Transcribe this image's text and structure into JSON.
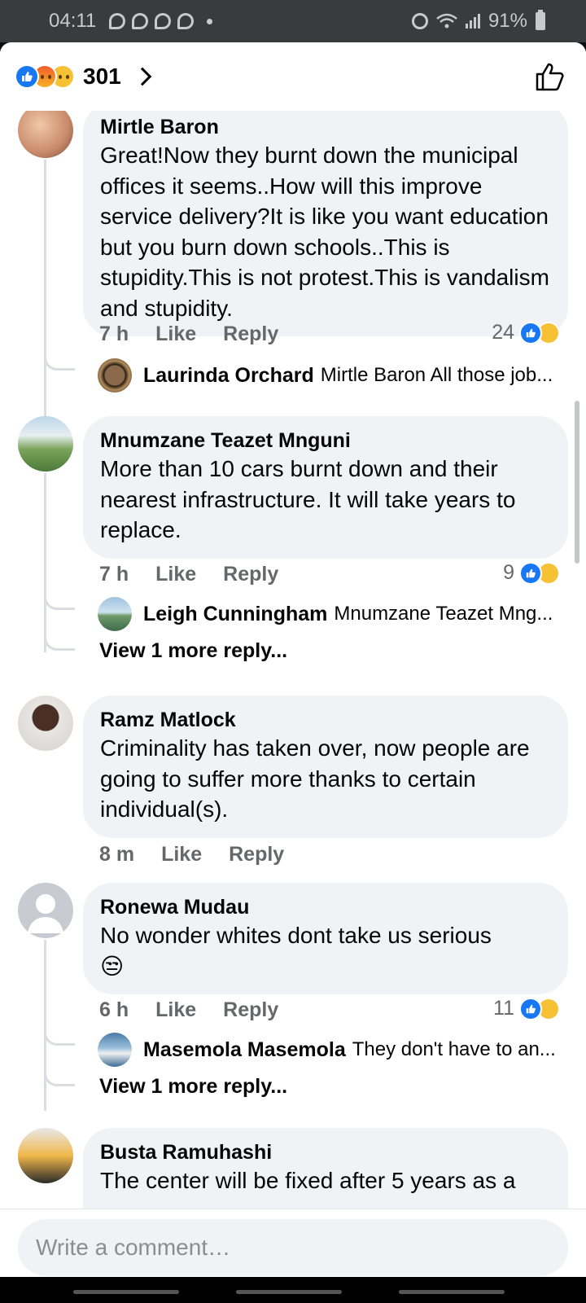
{
  "status_bar": {
    "time": "04:11",
    "battery": "91%"
  },
  "header": {
    "reaction_count": "301"
  },
  "comments": [
    {
      "author": "Mirtle Baron",
      "text": "Great!Now they burnt down the municipal offices it seems..How will this improve service delivery?It is like you want education but you burn down schools..This is stupidity.This is not protest.This is vandalism and stupidity.",
      "time": "7 h",
      "like": "Like",
      "reply": "Reply",
      "reactions": "24",
      "replies": [
        {
          "author": "Laurinda Orchard",
          "text": "Mirtle Baron All those job..."
        }
      ]
    },
    {
      "author": "Mnumzane Teazet Mnguni",
      "text": "More than 10 cars burnt down and their nearest infrastructure. It will take years to replace.",
      "time": "7 h",
      "like": "Like",
      "reply": "Reply",
      "reactions": "9",
      "replies": [
        {
          "author": "Leigh Cunningham",
          "text": "Mnumzane Teazet Mng..."
        }
      ],
      "view_more": "View 1 more reply..."
    },
    {
      "author": "Ramz Matlock",
      "text": "Criminality has taken over, now people are going to suffer more thanks to certain individual(s).",
      "time": "8 m",
      "like": "Like",
      "reply": "Reply"
    },
    {
      "author": "Ronewa Mudau",
      "text": "No wonder whites dont take us serious",
      "emoji": "😒",
      "time": "6 h",
      "like": "Like",
      "reply": "Reply",
      "reactions": "11",
      "replies": [
        {
          "author": "Masemola Masemola",
          "text": "They don't have to an..."
        }
      ],
      "view_more": "View 1 more reply..."
    },
    {
      "author": "Busta Ramuhashi",
      "text": "The center will be fixed after 5 years as a"
    }
  ],
  "composer": {
    "placeholder": "Write a comment…"
  },
  "colors": {
    "accent": "#1877f2",
    "bubble": "#f0f2f5",
    "meta": "#65676b"
  }
}
